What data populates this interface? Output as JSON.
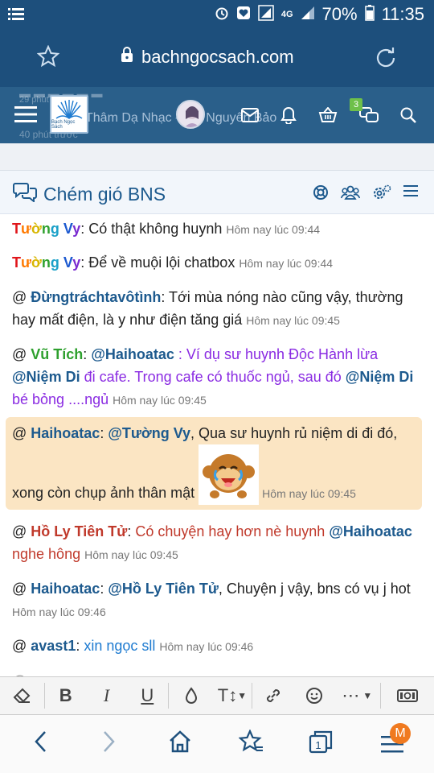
{
  "status": {
    "network": "4G",
    "battery": "70%",
    "time": "11:35"
  },
  "browser": {
    "url": "bachngocsach.com"
  },
  "forum": {
    "logo_text": "Bạch Ngọc Sách",
    "ghost_line": "Thâm Dạ Nhạc - Đại Nguyên Bảo",
    "ghost_time": "40 phút trước",
    "alert_count": "3"
  },
  "chat": {
    "title": "Chém gió BNS",
    "messages": [
      {
        "prefix": "",
        "user": "Tường Vy",
        "after_user": ": Có thật không huynh ",
        "time": "Hôm nay lúc 09:44"
      },
      {
        "prefix": "",
        "user": "Tường Vy",
        "after_user": ": Để về muội lội chatbox ",
        "time": "Hôm nay lúc 09:44"
      },
      {
        "prefix": "@ ",
        "user": "Đừngtráchtavôtình",
        "after_user": ": Tới mùa nóng nào cũng vậy, thường hay mất điện, là y như điện tăng giá ",
        "time": "Hôm nay lúc 09:45"
      },
      {
        "prefix": "@ ",
        "user": "Vũ Tích",
        "colon": ": ",
        "mention1": "@Haihoatac",
        "text1": " : Ví dụ sư huynh Độc Hành lừa ",
        "mention2": "@Niệm Di",
        "text2": " đi cafe. Trong cafe có thuốc ngủ, sau đó ",
        "mention3": "@Niệm Di",
        "text3": " bé bỏng ....ngủ ",
        "time": "Hôm nay lúc 09:45"
      },
      {
        "prefix": "@ ",
        "user": "Haihoatac",
        "colon": ": ",
        "mention1": "@Tường Vy",
        "text1": ", Qua sư huynh rủ niệm di đi đó, xong còn chụp ảnh thân mật ",
        "time": "Hôm nay lúc 09:45"
      },
      {
        "prefix": "@ ",
        "user": "Hồ Ly Tiên Tử",
        "colon": ": ",
        "text1": "Có chuyện hay hơn nè huynh ",
        "mention1": "@Haihoatac",
        "text2": " nghe hông ",
        "time": "Hôm nay lúc 09:45"
      },
      {
        "prefix": "@ ",
        "user": "Haihoatac",
        "colon": ": ",
        "mention1": "@Hồ Ly Tiên Tử",
        "text1": ", Chuyện j vậy, bns có vụ j hot ",
        "time": "Hôm nay lúc 09:46"
      },
      {
        "prefix": "@ ",
        "user": "avast1",
        "colon": ": ",
        "text1": "xin ngọc sll ",
        "time": "Hôm nay lúc 09:46"
      }
    ]
  },
  "toolbar": {
    "bold": "B",
    "italic": "I",
    "underline": "U",
    "textsize": "T↕",
    "more": "⋯"
  },
  "bottomnav": {
    "tabs_count": "1",
    "profile_badge": "M"
  }
}
